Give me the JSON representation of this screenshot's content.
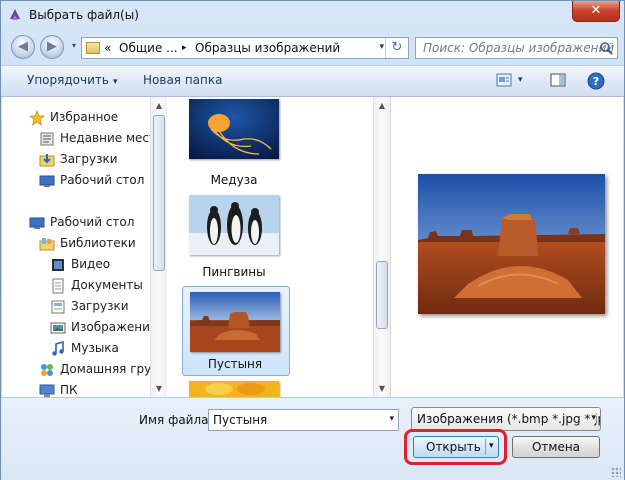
{
  "window": {
    "title": "Выбрать файл(ы)",
    "close_glyph": "✕"
  },
  "nav": {
    "back_glyph": "◀",
    "forward_glyph": "▶",
    "history_glyph": "▾",
    "address_prefix": "«",
    "address_segments": [
      "Общие ...",
      "Образцы изображений"
    ],
    "separator": "▸",
    "address_dropdown": "▾",
    "refresh_glyph": "↻",
    "search_placeholder": "Поиск: Образцы изображений"
  },
  "toolbar": {
    "organize_label": "Упорядочить",
    "organize_caret": "▾",
    "new_folder_label": "Новая папка",
    "view_caret": "▾",
    "help_glyph": "?"
  },
  "sidebar": {
    "items": [
      {
        "label": "Избранное",
        "icon": "star-icon"
      },
      {
        "label": "Недавние места",
        "icon": "recent-places-icon"
      },
      {
        "label": "Загрузки",
        "icon": "downloads-icon"
      },
      {
        "label": "Рабочий стол",
        "icon": "desktop-icon"
      },
      {
        "label": "Рабочий стол",
        "icon": "desktop-icon"
      },
      {
        "label": "Библиотеки",
        "icon": "libraries-icon"
      },
      {
        "label": "Видео",
        "icon": "video-library-icon"
      },
      {
        "label": "Документы",
        "icon": "documents-library-icon"
      },
      {
        "label": "Загрузки",
        "icon": "downloads-library-icon"
      },
      {
        "label": "Изображения",
        "icon": "pictures-library-icon"
      },
      {
        "label": "Музыка",
        "icon": "music-library-icon"
      },
      {
        "label": "Домашняя груп",
        "icon": "homegroup-icon"
      },
      {
        "label": "ПК",
        "icon": "computer-icon"
      }
    ]
  },
  "files": [
    {
      "name": "Медуза",
      "icon": "jellyfish-thumbnail",
      "selected": false
    },
    {
      "name": "Пингвины",
      "icon": "penguins-thumbnail",
      "selected": false
    },
    {
      "name": "Пустыня",
      "icon": "desert-thumbnail",
      "selected": true
    },
    {
      "name": "",
      "icon": "flower-thumbnail",
      "selected": false
    }
  ],
  "bottom": {
    "filename_label": "Имя файла:",
    "filename_value": "Пустыня",
    "filter_value": "Изображения (*.bmp *.jpg *.jp",
    "dropdown_glyph": "▾",
    "open_label": "Открыть",
    "cancel_label": "Отмена"
  },
  "colors": {
    "highlight": "#e0202a",
    "selection": "#cfe4fb"
  }
}
